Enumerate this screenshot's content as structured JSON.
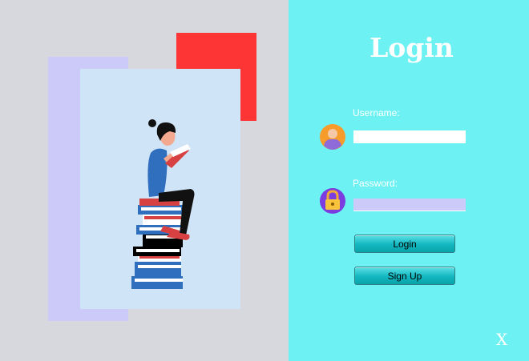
{
  "title": "Login",
  "username": {
    "label": "Username:",
    "value": ""
  },
  "password": {
    "label": "Password:",
    "value": ""
  },
  "buttons": {
    "login": "Login",
    "signup": "Sign Up",
    "close": "X"
  },
  "icons": {
    "username": "user-avatar-icon",
    "password": "padlock-icon",
    "illustration": "woman-reading-on-books"
  },
  "colors": {
    "right_panel": "#6df1f3",
    "left_panel": "#d6d8de",
    "accent_red": "#fd3535",
    "lavender": "#cbcaf9",
    "card": "#d0e4f7"
  }
}
